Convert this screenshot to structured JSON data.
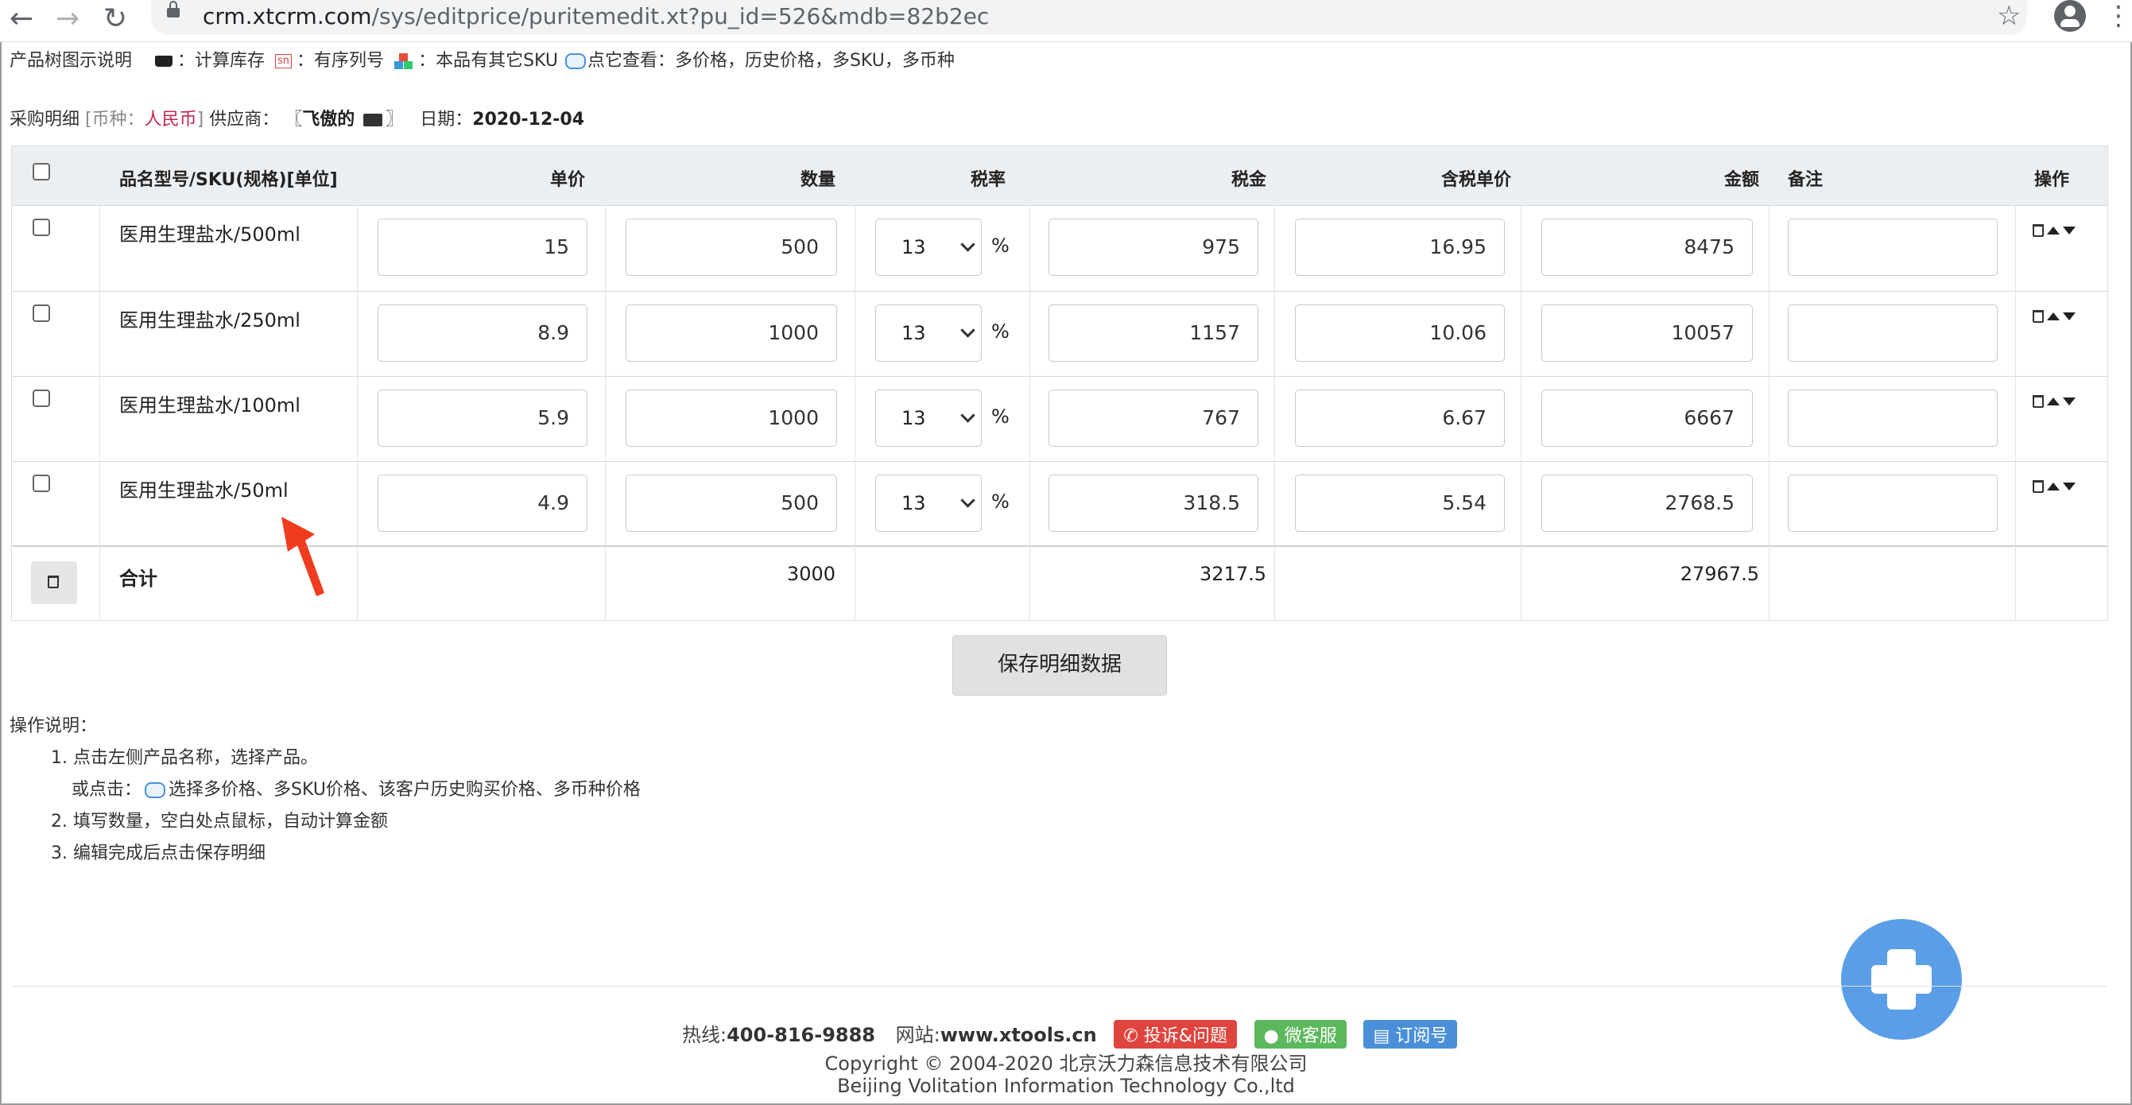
{
  "browser": {
    "url_host": "crm.xtcrm.com",
    "url_path": "/sys/editprice/puritemedit.xt?pu_id=526&mdb=82b2ec"
  },
  "legend": {
    "title": "产品树图示说明",
    "calc_stock": "：计算库存",
    "sn_icon_text": "sn",
    "sequence": "：有序列号",
    "other_sku": "：本品有其它SKU",
    "click_view": "点它查看：多价格，历史价格，多SKU，多币种"
  },
  "purchase": {
    "label": "采购明细",
    "currency_prefix": "[币种：",
    "currency": "人民币",
    "currency_suffix": "]",
    "supplier_label": "供应商：",
    "supplier_open": "〖",
    "supplier": "飞傲的",
    "supplier_close": "〗",
    "date_label": "日期：",
    "date": "2020-12-04"
  },
  "table": {
    "headers": {
      "name": "品名型号/SKU(规格)[单位]",
      "unit_price": "单价",
      "quantity": "数量",
      "tax_rate": "税率",
      "tax": "税金",
      "price_with_tax": "含税单价",
      "amount": "金额",
      "note": "备注",
      "ops": "操作"
    },
    "percent": "%",
    "rows": [
      {
        "name": "医用生理盐水/500ml",
        "unit_price": "15",
        "quantity": "500",
        "tax_rate": "13",
        "tax": "975",
        "price_with_tax": "16.95",
        "amount": "8475",
        "note": ""
      },
      {
        "name": "医用生理盐水/250ml",
        "unit_price": "8.9",
        "quantity": "1000",
        "tax_rate": "13",
        "tax": "1157",
        "price_with_tax": "10.06",
        "amount": "10057",
        "note": ""
      },
      {
        "name": "医用生理盐水/100ml",
        "unit_price": "5.9",
        "quantity": "1000",
        "tax_rate": "13",
        "tax": "767",
        "price_with_tax": "6.67",
        "amount": "6667",
        "note": ""
      },
      {
        "name": "医用生理盐水/50ml",
        "unit_price": "4.9",
        "quantity": "500",
        "tax_rate": "13",
        "tax": "318.5",
        "price_with_tax": "5.54",
        "amount": "2768.5",
        "note": ""
      }
    ],
    "total": {
      "label": "合计",
      "quantity": "3000",
      "tax": "3217.5",
      "amount": "27967.5"
    }
  },
  "save_button": "保存明细数据",
  "instructions": {
    "title": "操作说明：",
    "step1": "1. 点击左侧产品名称，选择产品。",
    "step1b_prefix": "或点击：",
    "step1b": "选择多价格、多SKU价格、该客户历史购买价格、多币种价格",
    "step2": "2. 填写数量，空白处点鼠标，自动计算金额",
    "step3": "3. 编辑完成后点击保存明细"
  },
  "footer": {
    "hotline_label": "热线:",
    "hotline": "400-816-9888",
    "site_label": "网站:",
    "site": "www.xtools.cn",
    "complaint": "投诉&问题",
    "wechat": "微客服",
    "subscribe": "订阅号",
    "copyright": "Copyright © 2004-2020 北京沃力森信息技术有限公司",
    "company_en": "Beijing Volitation Information Technology Co.,ltd"
  },
  "colors": {
    "complaint_badge": "#e0443e",
    "wechat_badge": "#5cb85c",
    "subscribe_badge": "#4a90d9",
    "fab": "#5a9ee8",
    "annotation_arrow": "#f03c1e"
  }
}
